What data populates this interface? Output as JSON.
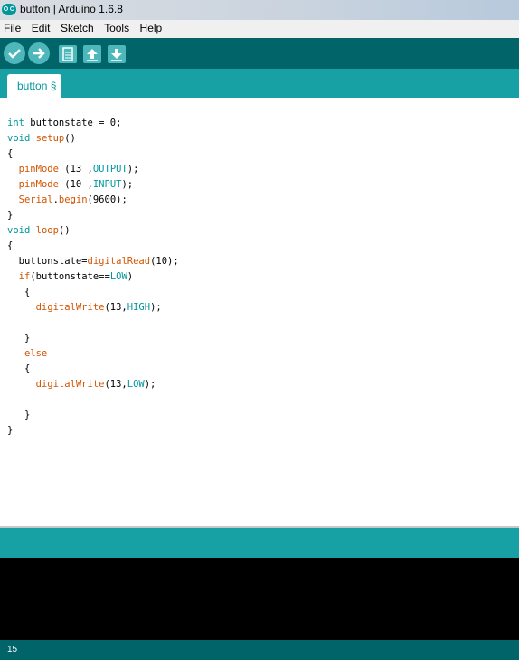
{
  "window": {
    "title": "button | Arduino 1.6.8"
  },
  "menu": [
    "File",
    "Edit",
    "Sketch",
    "Tools",
    "Help"
  ],
  "toolbar": {
    "verify_icon": "check-icon",
    "upload_icon": "arrow-right-icon",
    "new_icon": "document-icon",
    "open_icon": "arrow-up-icon",
    "save_icon": "arrow-down-icon"
  },
  "tab": {
    "label": "button §"
  },
  "code": [
    [
      [
        "int",
        "kw"
      ],
      [
        " buttonstate = 0;",
        ""
      ]
    ],
    [
      [
        "void",
        "kw"
      ],
      [
        " ",
        ""
      ],
      [
        "setup",
        "fn"
      ],
      [
        "()",
        ""
      ]
    ],
    [
      [
        "{",
        ""
      ]
    ],
    [
      [
        "  ",
        ""
      ],
      [
        "pinMode",
        "fn"
      ],
      [
        " (13 ,",
        ""
      ],
      [
        "OUTPUT",
        "const"
      ],
      [
        ");",
        ""
      ]
    ],
    [
      [
        "  ",
        ""
      ],
      [
        "pinMode",
        "fn"
      ],
      [
        " (10 ,",
        ""
      ],
      [
        "INPUT",
        "const"
      ],
      [
        ");",
        ""
      ]
    ],
    [
      [
        "  ",
        ""
      ],
      [
        "Serial",
        "fn"
      ],
      [
        ".",
        ""
      ],
      [
        "begin",
        "fn"
      ],
      [
        "(9600);",
        ""
      ]
    ],
    [
      [
        "}",
        ""
      ]
    ],
    [
      [
        "void",
        "kw"
      ],
      [
        " ",
        ""
      ],
      [
        "loop",
        "fn"
      ],
      [
        "()",
        ""
      ]
    ],
    [
      [
        "{",
        ""
      ]
    ],
    [
      [
        "  buttonstate=",
        ""
      ],
      [
        "digitalRead",
        "fn"
      ],
      [
        "(10);",
        ""
      ]
    ],
    [
      [
        "  ",
        ""
      ],
      [
        "if",
        "fn"
      ],
      [
        "(buttonstate==",
        ""
      ],
      [
        "LOW",
        "const"
      ],
      [
        ")",
        ""
      ]
    ],
    [
      [
        "   {",
        ""
      ]
    ],
    [
      [
        "     ",
        ""
      ],
      [
        "digitalWrite",
        "fn"
      ],
      [
        "(13,",
        ""
      ],
      [
        "HIGH",
        "const"
      ],
      [
        ");",
        ""
      ]
    ],
    [
      [
        "",
        ""
      ]
    ],
    [
      [
        "   }",
        ""
      ]
    ],
    [
      [
        "   ",
        ""
      ],
      [
        "else",
        "fn"
      ]
    ],
    [
      [
        "   {",
        ""
      ]
    ],
    [
      [
        "     ",
        ""
      ],
      [
        "digitalWrite",
        "fn"
      ],
      [
        "(13,",
        ""
      ],
      [
        "LOW",
        "const"
      ],
      [
        ");",
        ""
      ]
    ],
    [
      [
        "",
        ""
      ]
    ],
    [
      [
        "   }",
        ""
      ]
    ],
    [
      [
        "}",
        ""
      ]
    ]
  ],
  "footer": {
    "line_number": "15"
  },
  "colors": {
    "toolbar": "#006468",
    "tabstrip": "#17a1a5",
    "keyword": "#00979c",
    "function": "#d35400"
  }
}
